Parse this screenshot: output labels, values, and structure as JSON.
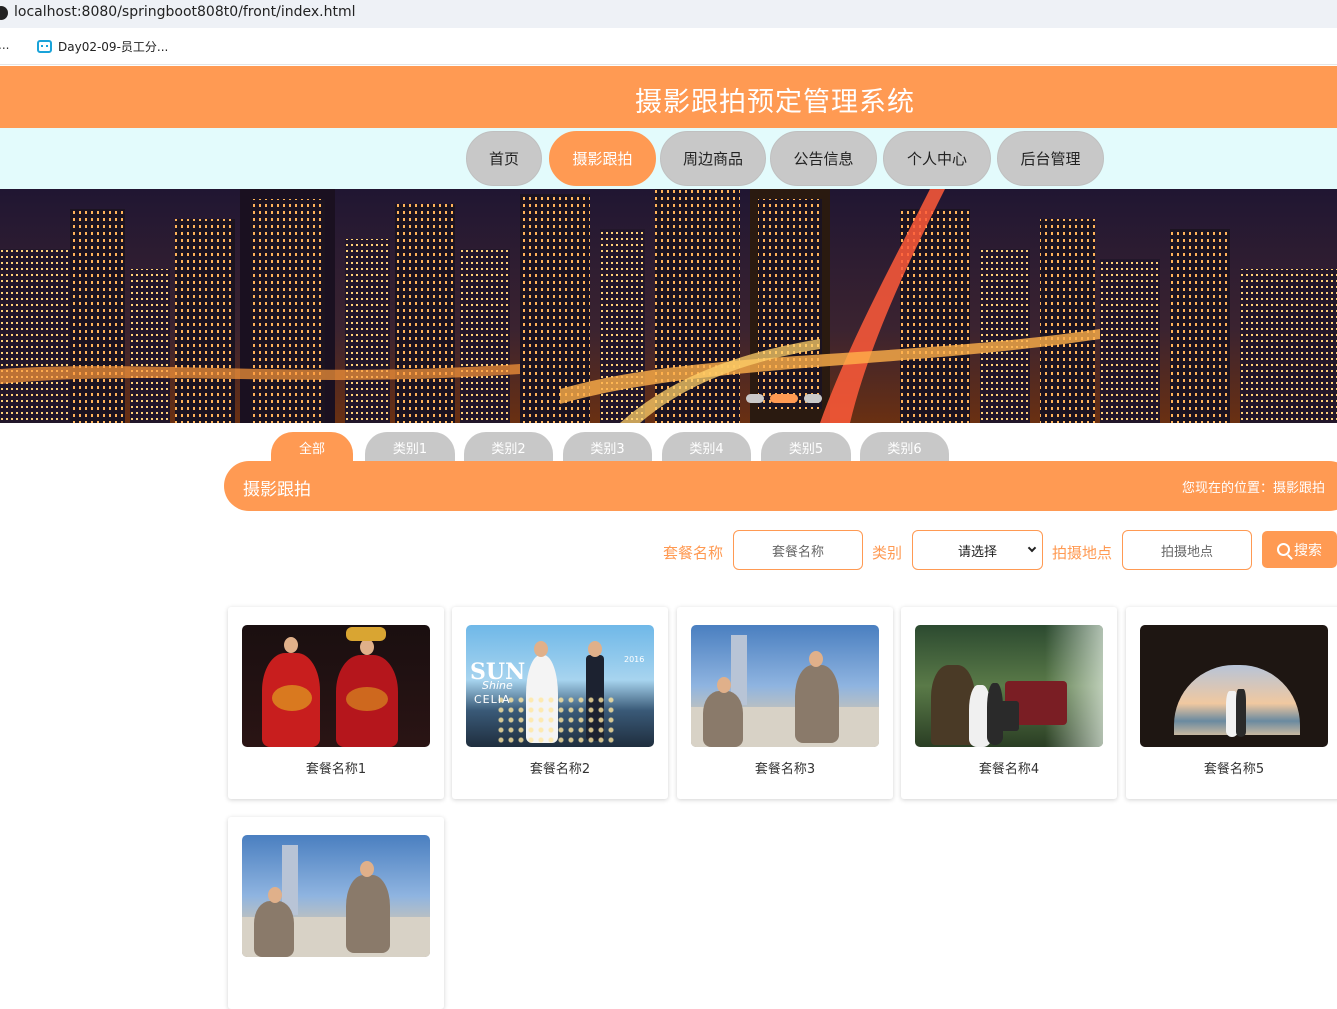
{
  "browser": {
    "url": "localhost:8080/springboot808t0/front/index.html",
    "bookmark_left": "...",
    "bookmark": "Day02-09-员工分..."
  },
  "header": {
    "title": "摄影跟拍预定管理系统"
  },
  "nav": [
    {
      "label": "首页",
      "active": false
    },
    {
      "label": "摄影跟拍",
      "active": true
    },
    {
      "label": "周边商品",
      "active": false
    },
    {
      "label": "公告信息",
      "active": false
    },
    {
      "label": "个人中心",
      "active": false
    },
    {
      "label": "后台管理",
      "active": false
    }
  ],
  "carousel": {
    "slides": 3,
    "active_index": 1
  },
  "categories": [
    "全部",
    "类别1",
    "类别2",
    "类别3",
    "类别4",
    "类别5",
    "类别6"
  ],
  "section": {
    "title": "摄影跟拍",
    "breadcrumb_prefix": "您现在的位置：",
    "breadcrumb_current": "摄影跟拍"
  },
  "search": {
    "name_label": "套餐名称",
    "name_placeholder": "套餐名称",
    "category_label": "类别",
    "category_selected": "请选择",
    "location_label": "拍摄地点",
    "location_placeholder": "拍摄地点",
    "button_label": "搜索"
  },
  "items": [
    {
      "name": "套餐名称1"
    },
    {
      "name": "套餐名称2"
    },
    {
      "name": "套餐名称3"
    },
    {
      "name": "套餐名称4"
    },
    {
      "name": "套餐名称5"
    },
    {
      "name": ""
    }
  ],
  "photo_texts": {
    "sun": "SUN",
    "shine": "Shine",
    "celia": "CELIA",
    "year": "2016"
  },
  "colors": {
    "accent": "#ff9a53",
    "inactive": "#c8c8c8",
    "nav_bg": "#e3fbfc"
  }
}
